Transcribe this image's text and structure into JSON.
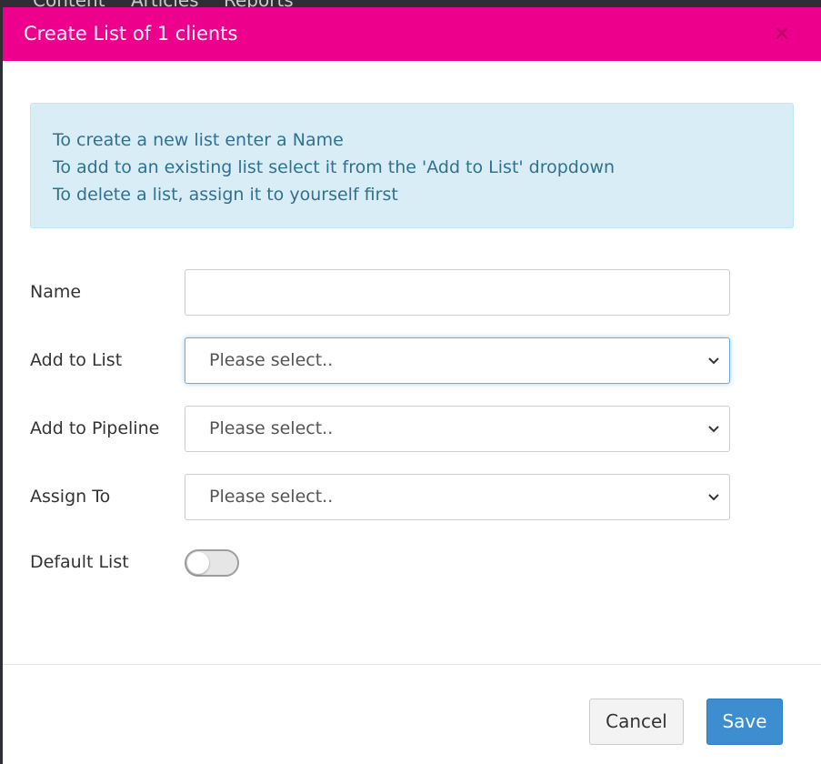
{
  "background_nav": {
    "items": [
      "Content",
      "Articles",
      "Reports"
    ]
  },
  "modal": {
    "title": "Create List of 1 clients",
    "close_glyph": "×",
    "header_color": "#ec008c",
    "info": {
      "lines": [
        "To create a new list enter a Name",
        "To add to an existing list select it from the 'Add to List' dropdown",
        "To delete a list, assign it to yourself first"
      ]
    },
    "form": {
      "name": {
        "label": "Name",
        "value": "",
        "placeholder": ""
      },
      "add_to_list": {
        "label": "Add to List",
        "value": "Please select.."
      },
      "add_to_pipeline": {
        "label": "Add to Pipeline",
        "value": "Please select.."
      },
      "assign_to": {
        "label": "Assign To",
        "value": "Please select.."
      },
      "default_list": {
        "label": "Default List",
        "enabled": false
      }
    },
    "footer": {
      "cancel_label": "Cancel",
      "save_label": "Save",
      "save_color": "#3c8ed0"
    }
  }
}
